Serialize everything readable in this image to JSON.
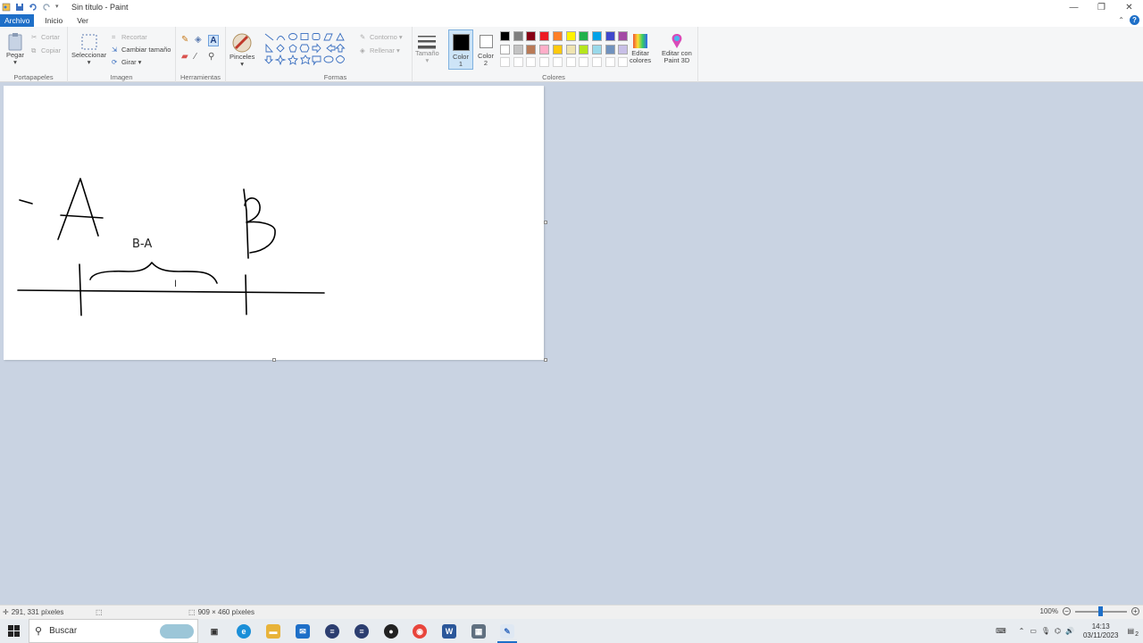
{
  "window": {
    "title": "Sin título - Paint"
  },
  "tabs": [
    {
      "label": "Archivo"
    },
    {
      "label": "Inicio"
    },
    {
      "label": "Ver"
    }
  ],
  "ribbon": {
    "clipboard": {
      "paste": "Pegar",
      "cut": "Cortar",
      "copy": "Copiar",
      "group": "Portapapeles"
    },
    "image": {
      "select": "Seleccionar",
      "crop": "Recortar",
      "resize": "Cambiar tamaño",
      "rotate": "Girar",
      "group": "Imagen"
    },
    "tools": {
      "group": "Herramientas"
    },
    "brushes": {
      "label": "Pinceles"
    },
    "shapes": {
      "outline": "Contorno",
      "fill": "Rellenar",
      "group": "Formas"
    },
    "size": {
      "label": "Tamaño"
    },
    "color1": {
      "label": "Color",
      "sub": "1"
    },
    "color2": {
      "label": "Color",
      "sub": "2"
    },
    "edit_colors": {
      "label1": "Editar",
      "label2": "colores"
    },
    "paint3d": {
      "label1": "Editar con",
      "label2": "Paint 3D"
    },
    "colors_group": "Colores",
    "palette_row1": [
      "#000000",
      "#7f7f7f",
      "#880015",
      "#ed1c24",
      "#ff7f27",
      "#fff200",
      "#22b14c",
      "#00a2e8",
      "#3f48cc",
      "#a349a4"
    ],
    "palette_row2": [
      "#ffffff",
      "#c3c3c3",
      "#b97a57",
      "#ffaec9",
      "#ffc90e",
      "#efe4b0",
      "#b5e61d",
      "#99d9ea",
      "#7092be",
      "#c8bfe7"
    ]
  },
  "canvas": {
    "label_ba": "B-A"
  },
  "status": {
    "cursor_pos": "291, 331 píxeles",
    "image_size": "909 × 460 píxeles",
    "zoom": "100%"
  },
  "taskbar": {
    "search": "Buscar",
    "time": "14:13",
    "date": "03/11/2023",
    "notifications": "2"
  }
}
